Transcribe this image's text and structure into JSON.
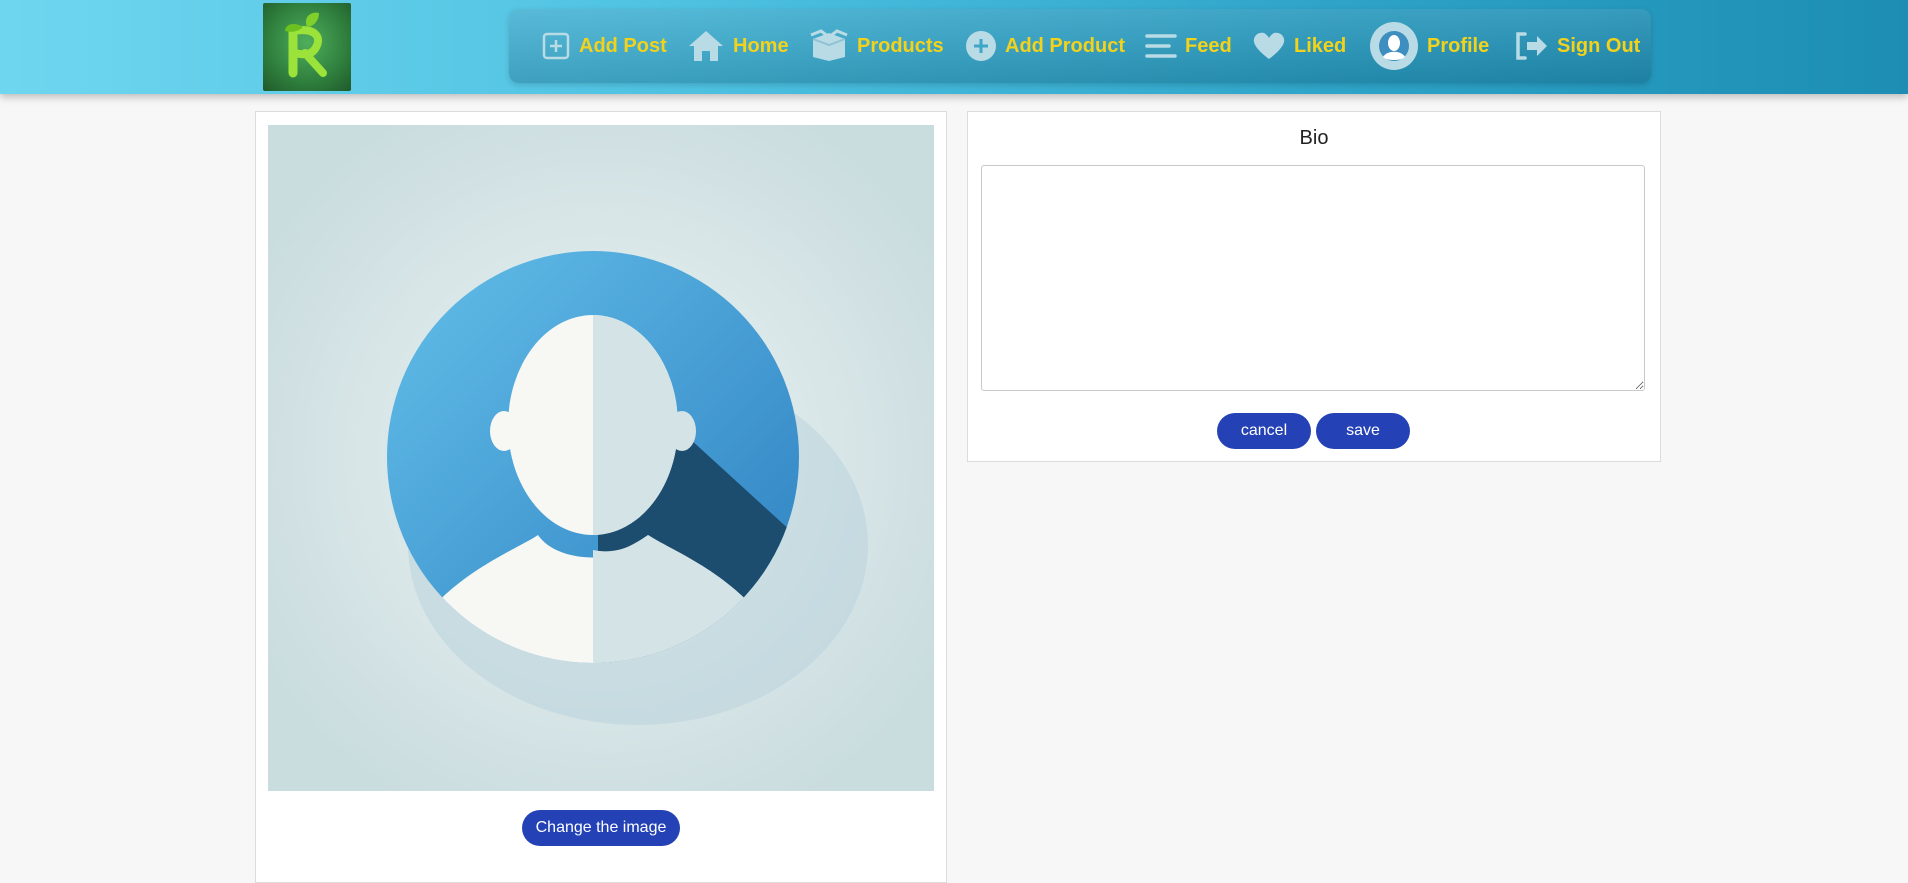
{
  "nav": {
    "items": [
      {
        "label": "Add Post",
        "icon": "add-post-icon"
      },
      {
        "label": "Home",
        "icon": "home-icon"
      },
      {
        "label": "Products",
        "icon": "box-icon"
      },
      {
        "label": "Add Product",
        "icon": "plus-circle-icon"
      },
      {
        "label": "Feed",
        "icon": "menu-lines-icon"
      },
      {
        "label": "Liked",
        "icon": "heart-icon"
      },
      {
        "label": "Profile",
        "icon": "profile-avatar-icon"
      },
      {
        "label": "Sign Out",
        "icon": "sign-out-icon"
      }
    ],
    "label_color": "#f2d21a"
  },
  "profile": {
    "change_image_label": "Change the image"
  },
  "bio": {
    "title": "Bio",
    "value": "",
    "cancel_label": "cancel",
    "save_label": "save"
  },
  "colors": {
    "primary_button": "#2442b5",
    "header_gradient_start": "#6fd6ef",
    "header_gradient_end": "#1d8db3"
  }
}
